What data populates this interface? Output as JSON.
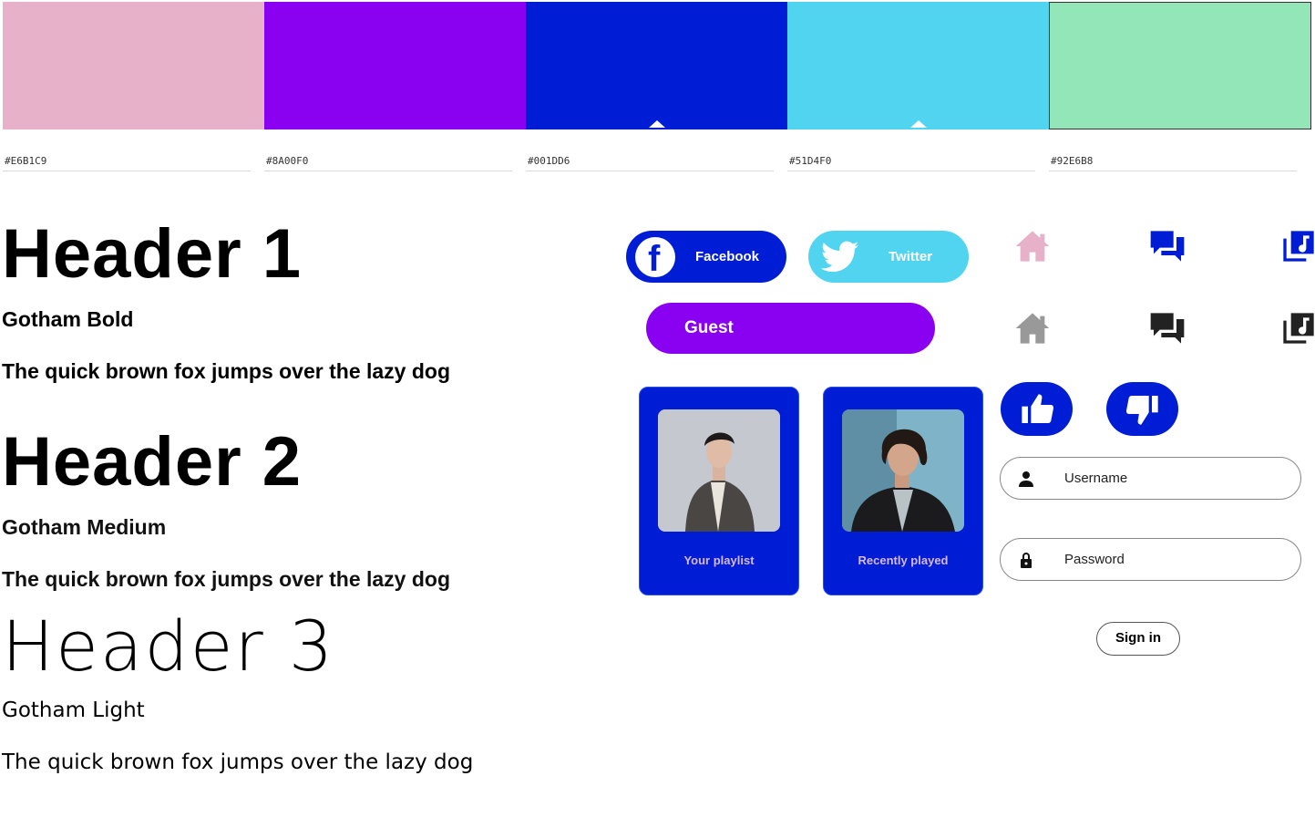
{
  "palette": {
    "swatches": [
      {
        "hex": "#E6B1C9",
        "label": "#E6B1C9"
      },
      {
        "hex": "#8A00F0",
        "label": "#8A00F0"
      },
      {
        "hex": "#001DD6",
        "label": "#001DD6"
      },
      {
        "hex": "#51D4F0",
        "label": "#51D4F0"
      },
      {
        "hex": "#92E6B8",
        "label": "#92E6B8"
      }
    ]
  },
  "typography": {
    "h1": {
      "title": "Header 1",
      "font": "Gotham Bold",
      "pangram": "The quick brown fox jumps over the lazy dog"
    },
    "h2": {
      "title": "Header 2",
      "font": "Gotham Medium",
      "pangram": "The quick brown fox jumps over the lazy dog"
    },
    "h3": {
      "title": "Header 3",
      "font": "Gotham Light",
      "pangram": "The quick brown fox jumps over the lazy dog"
    }
  },
  "buttons": {
    "facebook": "Facebook",
    "twitter": "Twitter",
    "guest": "Guest",
    "sign_in": "Sign in"
  },
  "icons": {
    "row1": [
      "home-icon",
      "chat-icon",
      "music-library-icon"
    ],
    "row2": [
      "home-icon",
      "chat-icon",
      "music-library-icon"
    ],
    "row1_colors": [
      "#E6B1C9",
      "#001DD6",
      "#001DD6"
    ],
    "row2_colors": [
      "#999999",
      "#222222",
      "#222222"
    ]
  },
  "cards": [
    {
      "caption": "Your playlist"
    },
    {
      "caption": "Recently played"
    }
  ],
  "login": {
    "username_placeholder": "Username",
    "password_placeholder": "Password"
  }
}
